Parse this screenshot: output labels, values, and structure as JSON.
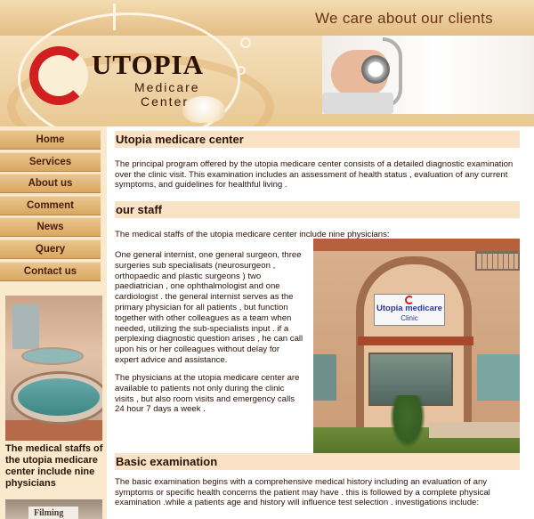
{
  "header": {
    "tagline": "We care about our clients",
    "logo_title": "UTOPIA",
    "logo_line1": "Medicare",
    "logo_line2": "Center"
  },
  "nav": {
    "items": [
      {
        "label": "Home"
      },
      {
        "label": "Services"
      },
      {
        "label": "About us"
      },
      {
        "label": "Comment"
      },
      {
        "label": "News"
      },
      {
        "label": "Query"
      },
      {
        "label": "Contact us"
      }
    ]
  },
  "sidebar": {
    "caption": "The medical staffs of the utopia medicare center include nine physicians",
    "photo2_text": "Filming"
  },
  "main": {
    "section1_title": "Utopia medicare center",
    "section1_text": "The principal program offered by the utopia medicare center consists of a detailed diagnostic examination over the clinic visit. This examination includes an assessment of health status , evaluation of any current symptoms, and guidelines for healthful living .",
    "section2_title": "our staff",
    "staff_intro": "The medical staffs of the utopia medicare center include nine physicians:",
    "staff_detail": "One general internist, one general surgeon, three surgeries sub specialisats (neurosurgeon , orthopaedic and plastic surgeons ) two paediatrician , one ophthalmologist and one cardiologist . the general internist serves as the primary physician for all patients , but function together with other colleagues as a team when needed, utilizing the sub-specialists input . if a perplexing diagnostic question arises , he can call upon his or her colleagues without delay for expert advice and assistance.",
    "physicians_text": "The physicians at the utopia medicare center are available to patients not only during the clinic visits , but also room visits and emergency calls 24 hour 7 days a week .",
    "clinic_sign_name": "Utopia medicare",
    "clinic_sign_sub": "Clinic",
    "section3_title": "Basic examination",
    "section3_text": "The basic examination begins with a comprehensive medical history including an evaluation of any symptoms or specific health concerns the patient may have . this is followed by a complete physical examination .while a patients age and history will influence test selection . investigations include:"
  },
  "colors": {
    "nav_button": "#d9a861",
    "heading_bg": "#f9e2c5",
    "sidebar_bg": "#fbe9ce",
    "text": "#2b1206",
    "logo_red": "#d11f1f"
  }
}
